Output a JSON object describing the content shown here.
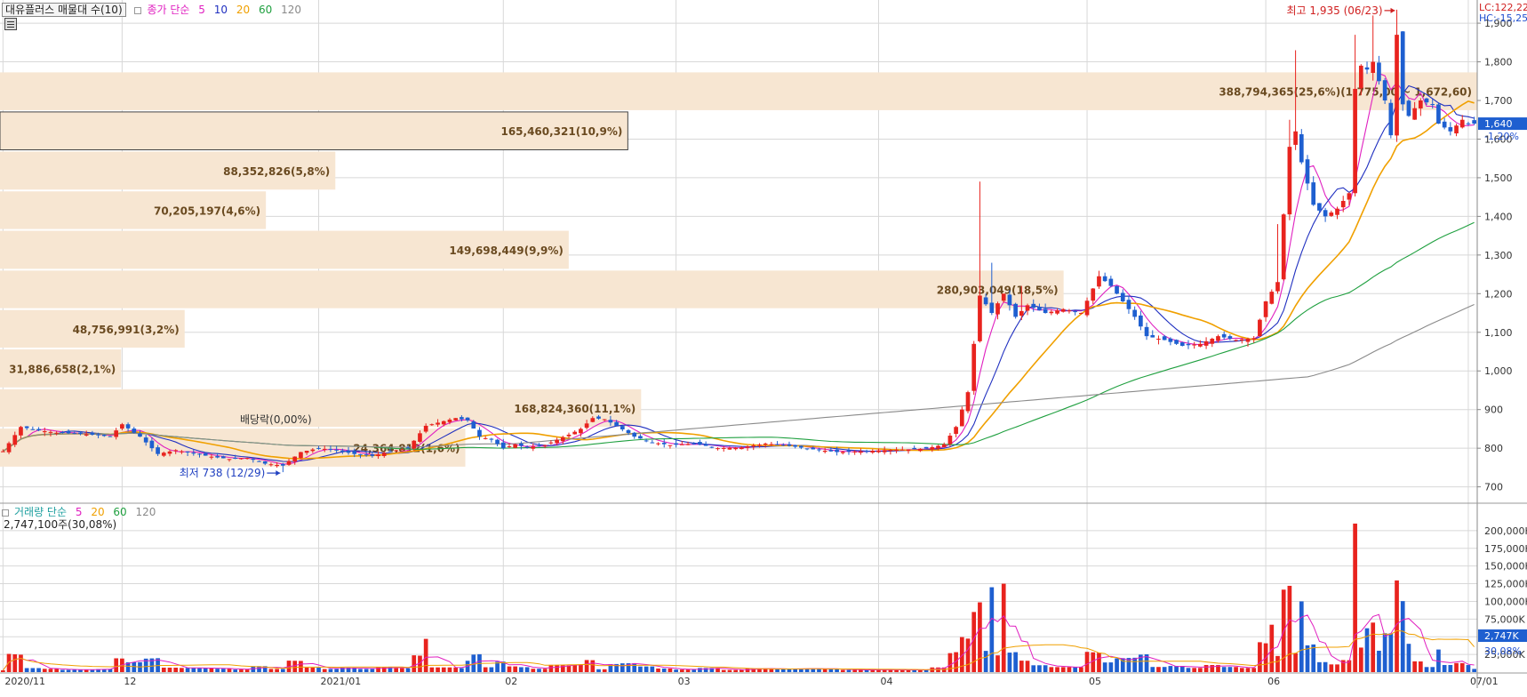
{
  "window": {
    "stock_label": "대유플러스 매물대 수(10)",
    "price_legend": {
      "name": "종가 단순",
      "periods": [
        "5",
        "10",
        "20",
        "60",
        "120"
      ]
    },
    "volume_legend": {
      "name": "거래량 단순",
      "periods": [
        "5",
        "20",
        "60",
        "120"
      ]
    },
    "volume_summary": "2,747,100주(30,08%)",
    "lc_label": "LC:122,22",
    "hc_label": "HC:-15,25",
    "last_price_badge": "1,640",
    "last_change": "-1,20%",
    "volume_badge": "2,747K",
    "volume_pct": "30,08%"
  },
  "colors": {
    "up": "#e8231e",
    "down": "#1e5fd0",
    "ma5": "#e020c0",
    "ma10": "#2030c0",
    "ma20": "#f0a000",
    "ma60": "#20a040",
    "ma120": "#8a8a8a",
    "profile_bar": "#f7e6d2",
    "grid": "#d8d8d8"
  },
  "chart_data": {
    "type": "candlestick",
    "y_axis": {
      "ticks": [
        "1,900",
        "1,800",
        "1,700",
        "1,600",
        "1,500",
        "1,400",
        "1,300",
        "1,200",
        "1,100",
        "1,000",
        "900",
        "800",
        "700"
      ],
      "range": [
        660,
        1960
      ]
    },
    "volume_axis": {
      "ticks": [
        "200,000K",
        "175,000K",
        "150,000K",
        "125,000K",
        "100,000K",
        "75,000K",
        "50,000K",
        "25,000K"
      ],
      "range": [
        0,
        225000
      ]
    },
    "x_labels": [
      {
        "label": "2020/11",
        "idx": 0
      },
      {
        "label": "12",
        "idx": 20
      },
      {
        "label": "2021/01",
        "idx": 53
      },
      {
        "label": "02",
        "idx": 84
      },
      {
        "label": "03",
        "idx": 113
      },
      {
        "label": "04",
        "idx": 147
      },
      {
        "label": "05",
        "idx": 182
      },
      {
        "label": "06",
        "idx": 212
      },
      {
        "label": "07/01",
        "idx": 246
      }
    ],
    "volume_profile": [
      {
        "label": "388,794,365(25,6%)(1,775,00 ~ 1,672,60)",
        "lo": 1672.6,
        "hi": 1775,
        "length": 1.0
      },
      {
        "label": "165,460,321(10,9%)",
        "lo": 1570,
        "hi": 1672.6,
        "length": 0.425
      },
      {
        "label": "88,352,826(5,8%)",
        "lo": 1467,
        "hi": 1570,
        "length": 0.227
      },
      {
        "label": "70,205,197(4,6%)",
        "lo": 1365,
        "hi": 1467,
        "length": 0.18
      },
      {
        "label": "149,698,449(9,9%)",
        "lo": 1262,
        "hi": 1365,
        "length": 0.385
      },
      {
        "label": "280,903,049(18,5%)",
        "lo": 1160,
        "hi": 1262,
        "length": 0.72
      },
      {
        "label": "48,756,991(3,2%)",
        "lo": 1058,
        "hi": 1160,
        "length": 0.125
      },
      {
        "label": "31,886,658(2,1%)",
        "lo": 955,
        "hi": 1058,
        "length": 0.082
      },
      {
        "label": "168,824,360(11,1%)",
        "lo": 853,
        "hi": 955,
        "length": 0.434
      },
      {
        "label": "24,364,812(1,6%)",
        "lo": 750,
        "hi": 853,
        "length": 0.315
      }
    ],
    "annotations": [
      {
        "text": "최고 1,935 (06/23)",
        "kind": "high",
        "idx": 234,
        "price": 1935
      },
      {
        "text": "최저 738 (12/29)",
        "kind": "low",
        "idx": 47,
        "price": 738
      },
      {
        "text": "배당락(0,00%)",
        "kind": "event",
        "idx": 47,
        "price": 800
      }
    ],
    "last_close": 1640,
    "anchors": {
      "close": [
        [
          0,
          792
        ],
        [
          3,
          855
        ],
        [
          6,
          846
        ],
        [
          9,
          840
        ],
        [
          12,
          838
        ],
        [
          15,
          835
        ],
        [
          18,
          830
        ],
        [
          20,
          862
        ],
        [
          23,
          830
        ],
        [
          26,
          785
        ],
        [
          29,
          795
        ],
        [
          32,
          786
        ],
        [
          35,
          778
        ],
        [
          38,
          772
        ],
        [
          41,
          775
        ],
        [
          44,
          760
        ],
        [
          47,
          755
        ],
        [
          50,
          790
        ],
        [
          53,
          800
        ],
        [
          56,
          795
        ],
        [
          59,
          785
        ],
        [
          62,
          780
        ],
        [
          65,
          792
        ],
        [
          68,
          800
        ],
        [
          71,
          858
        ],
        [
          72,
          862
        ],
        [
          74,
          870
        ],
        [
          76,
          878
        ],
        [
          78,
          872
        ],
        [
          80,
          830
        ],
        [
          82,
          822
        ],
        [
          84,
          800
        ],
        [
          86,
          810
        ],
        [
          88,
          802
        ],
        [
          91,
          808
        ],
        [
          93,
          822
        ],
        [
          95,
          835
        ],
        [
          97,
          850
        ],
        [
          99,
          878
        ],
        [
          101,
          875
        ],
        [
          103,
          858
        ],
        [
          106,
          830
        ],
        [
          109,
          815
        ],
        [
          112,
          808
        ],
        [
          116,
          812
        ],
        [
          120,
          800
        ],
        [
          124,
          802
        ],
        [
          128,
          812
        ],
        [
          132,
          806
        ],
        [
          136,
          797
        ],
        [
          140,
          790
        ],
        [
          144,
          792
        ],
        [
          148,
          795
        ],
        [
          152,
          797
        ],
        [
          155,
          799
        ],
        [
          158,
          810
        ],
        [
          160,
          855
        ],
        [
          162,
          945
        ],
        [
          164,
          1195
        ],
        [
          166,
          1150
        ],
        [
          168,
          1200
        ],
        [
          170,
          1140
        ],
        [
          172,
          1170
        ],
        [
          175,
          1150
        ],
        [
          178,
          1160
        ],
        [
          181,
          1150
        ],
        [
          184,
          1245
        ],
        [
          186,
          1220
        ],
        [
          188,
          1180
        ],
        [
          190,
          1140
        ],
        [
          192,
          1090
        ],
        [
          195,
          1080
        ],
        [
          198,
          1065
        ],
        [
          201,
          1070
        ],
        [
          204,
          1090
        ],
        [
          207,
          1080
        ],
        [
          210,
          1085
        ],
        [
          212,
          1180
        ],
        [
          214,
          1230
        ],
        [
          216,
          1580
        ],
        [
          217,
          1620
        ],
        [
          218,
          1540
        ],
        [
          220,
          1430
        ],
        [
          222,
          1400
        ],
        [
          224,
          1420
        ],
        [
          226,
          1460
        ],
        [
          227,
          1730
        ],
        [
          228,
          1790
        ],
        [
          229,
          1780
        ],
        [
          230,
          1800
        ],
        [
          232,
          1700
        ],
        [
          233,
          1610
        ],
        [
          234,
          1870
        ],
        [
          235,
          1690
        ],
        [
          236,
          1660
        ],
        [
          237,
          1680
        ],
        [
          238,
          1700
        ],
        [
          240,
          1690
        ],
        [
          241,
          1640
        ],
        [
          243,
          1620
        ],
        [
          245,
          1650
        ],
        [
          246,
          1640
        ]
      ]
    }
  }
}
